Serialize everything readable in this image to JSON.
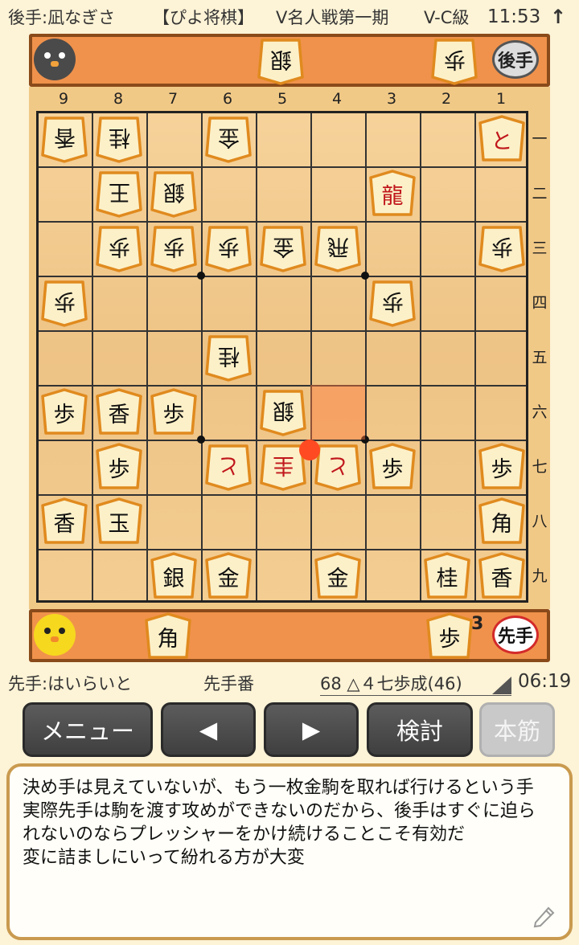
{
  "header": {
    "gote_player": "後手:凪なぎさ",
    "app_title": "【ぴよ将棋】",
    "event": "V名人戦第一期",
    "class": "V-C級",
    "clock": "11:53",
    "arrow": "↑"
  },
  "gote_hand": {
    "pieces": [
      {
        "glyph": "銀"
      },
      {
        "glyph": "歩"
      }
    ],
    "badge": "後手"
  },
  "sente_hand": {
    "pieces": [
      {
        "glyph": "角"
      },
      {
        "glyph": "歩",
        "count": "3"
      }
    ],
    "badge": "先手"
  },
  "board": {
    "files": [
      "9",
      "8",
      "7",
      "6",
      "5",
      "4",
      "3",
      "2",
      "1"
    ],
    "ranks": [
      "一",
      "二",
      "三",
      "四",
      "五",
      "六",
      "七",
      "八",
      "九"
    ],
    "pieces": [
      {
        "glyph": "香",
        "file": 9,
        "rank": 1,
        "owner": "gote"
      },
      {
        "glyph": "桂",
        "file": 8,
        "rank": 1,
        "owner": "gote"
      },
      {
        "glyph": "金",
        "file": 6,
        "rank": 1,
        "owner": "gote"
      },
      {
        "glyph": "と",
        "file": 1,
        "rank": 1,
        "owner": "sente",
        "promoted": true
      },
      {
        "glyph": "王",
        "file": 8,
        "rank": 2,
        "owner": "gote"
      },
      {
        "glyph": "銀",
        "file": 7,
        "rank": 2,
        "owner": "gote"
      },
      {
        "glyph": "龍",
        "file": 3,
        "rank": 2,
        "owner": "sente",
        "promoted": true
      },
      {
        "glyph": "歩",
        "file": 8,
        "rank": 3,
        "owner": "gote"
      },
      {
        "glyph": "歩",
        "file": 7,
        "rank": 3,
        "owner": "gote"
      },
      {
        "glyph": "歩",
        "file": 6,
        "rank": 3,
        "owner": "gote"
      },
      {
        "glyph": "金",
        "file": 5,
        "rank": 3,
        "owner": "gote"
      },
      {
        "glyph": "飛",
        "file": 4,
        "rank": 3,
        "owner": "gote"
      },
      {
        "glyph": "歩",
        "file": 1,
        "rank": 3,
        "owner": "gote"
      },
      {
        "glyph": "歩",
        "file": 9,
        "rank": 4,
        "owner": "gote"
      },
      {
        "glyph": "歩",
        "file": 3,
        "rank": 4,
        "owner": "gote"
      },
      {
        "glyph": "桂",
        "file": 6,
        "rank": 5,
        "owner": "gote"
      },
      {
        "glyph": "歩",
        "file": 9,
        "rank": 6,
        "owner": "sente"
      },
      {
        "glyph": "香",
        "file": 8,
        "rank": 6,
        "owner": "sente"
      },
      {
        "glyph": "歩",
        "file": 7,
        "rank": 6,
        "owner": "sente"
      },
      {
        "glyph": "銀",
        "file": 5,
        "rank": 6,
        "owner": "gote"
      },
      {
        "glyph": "歩",
        "file": 8,
        "rank": 7,
        "owner": "sente"
      },
      {
        "glyph": "と",
        "file": 6,
        "rank": 7,
        "owner": "gote",
        "promoted": true
      },
      {
        "glyph": "圭",
        "file": 5,
        "rank": 7,
        "owner": "gote",
        "promoted": true
      },
      {
        "glyph": "と",
        "file": 4,
        "rank": 7,
        "owner": "gote",
        "promoted": true
      },
      {
        "glyph": "歩",
        "file": 3,
        "rank": 7,
        "owner": "sente"
      },
      {
        "glyph": "歩",
        "file": 1,
        "rank": 7,
        "owner": "sente"
      },
      {
        "glyph": "香",
        "file": 9,
        "rank": 8,
        "owner": "sente"
      },
      {
        "glyph": "玉",
        "file": 8,
        "rank": 8,
        "owner": "sente"
      },
      {
        "glyph": "角",
        "file": 1,
        "rank": 8,
        "owner": "sente"
      },
      {
        "glyph": "銀",
        "file": 7,
        "rank": 9,
        "owner": "sente"
      },
      {
        "glyph": "金",
        "file": 6,
        "rank": 9,
        "owner": "sente"
      },
      {
        "glyph": "金",
        "file": 4,
        "rank": 9,
        "owner": "sente"
      },
      {
        "glyph": "桂",
        "file": 2,
        "rank": 9,
        "owner": "sente"
      },
      {
        "glyph": "香",
        "file": 1,
        "rank": 9,
        "owner": "sente"
      }
    ],
    "last_move_from": {
      "file": 4,
      "rank": 6
    },
    "last_move_to": {
      "file": 4,
      "rank": 7
    }
  },
  "info": {
    "sente_player": "先手:はいらいと",
    "turn": "先手番",
    "move": "68 △４七歩成(46)",
    "time": "06:19"
  },
  "buttons": {
    "menu": "メニュー",
    "prev": "◀",
    "next": "▶",
    "analyze": "検討",
    "mainline": "本筋"
  },
  "comment": "決め手は見えていないが、もう一枚金駒を取れば行けるという手\n実際先手は駒を渡す攻めができないのだから、後手はすぐに迫られないのならプレッシャーをかけ続けることこそ有効だ\n変に詰ましにいって紛れる方が大変",
  "colors": {
    "piece_face": "#fcf0c8",
    "piece_edge": "#e08a1e",
    "promoted_text": "#c0161b",
    "bar": "#f0924c"
  }
}
